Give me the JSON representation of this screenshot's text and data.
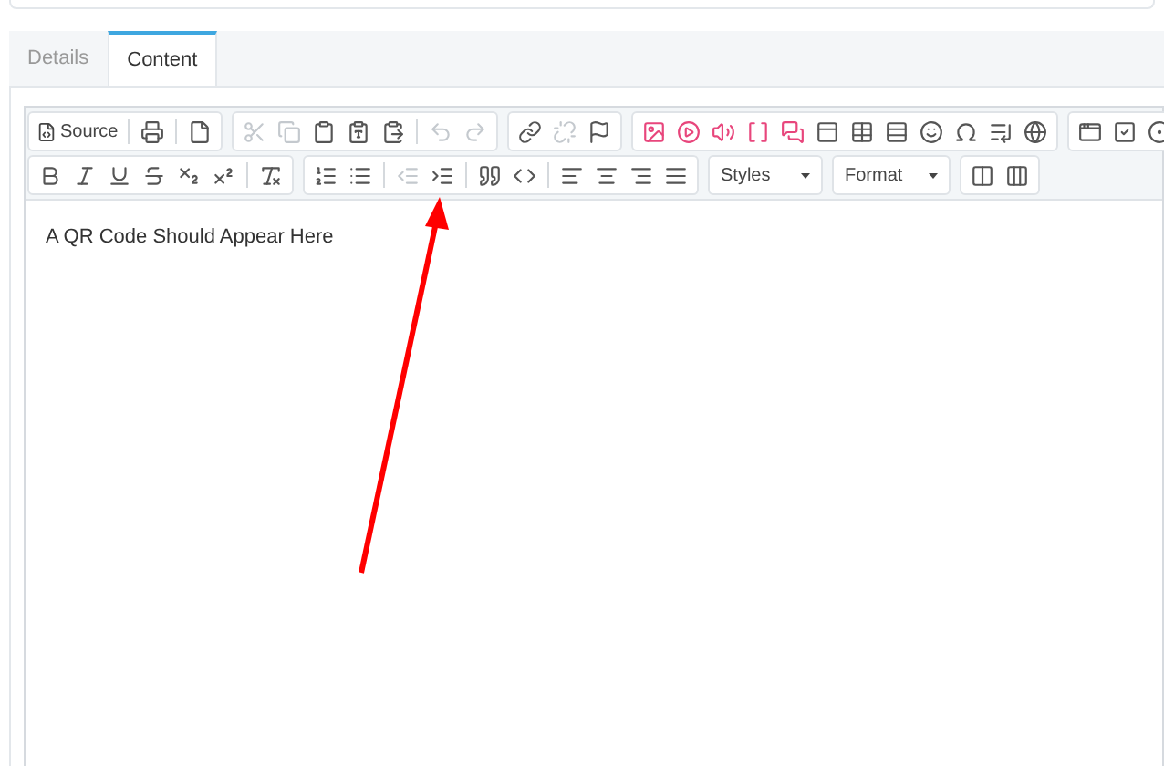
{
  "tabs": [
    {
      "label": "Details",
      "selected": false
    },
    {
      "label": "Content",
      "selected": true
    }
  ],
  "editor": {
    "source_button": "Source",
    "styles_dropdown": "Styles",
    "format_dropdown": "Format",
    "content": "A QR Code Should Appear Here"
  }
}
